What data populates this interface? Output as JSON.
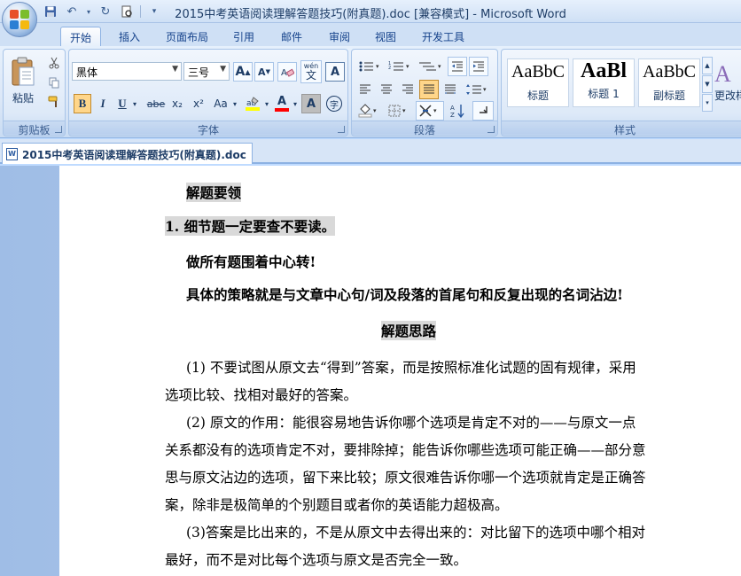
{
  "window": {
    "title": "2015中考英语阅读理解答题技巧(附真题).doc [兼容模式] - Microsoft Word"
  },
  "ribbon_tabs": [
    "开始",
    "插入",
    "页面布局",
    "引用",
    "邮件",
    "审阅",
    "视图",
    "开发工具"
  ],
  "clipboard": {
    "paste_label": "粘贴",
    "group_label": "剪贴板"
  },
  "font": {
    "font_name": "黑体",
    "font_size": "三号",
    "group_label": "字体",
    "bold": "B",
    "italic": "I",
    "underline": "U",
    "strike": "abe",
    "subscript": "x₂",
    "superscript": "x²",
    "change_case": "Aa",
    "grow": "A",
    "shrink": "A",
    "wen": "wén",
    "wen_char": "文",
    "border_char": "A",
    "color_char": "A",
    "shade_char": "A",
    "enclose_char": "字"
  },
  "paragraph": {
    "group_label": "段落"
  },
  "styles": {
    "group_label": "样式",
    "items": [
      {
        "sample": "AaBbC",
        "name": "标题"
      },
      {
        "sample": "AaBl",
        "name": "标题 1"
      },
      {
        "sample": "AaBbC",
        "name": "副标题"
      }
    ],
    "change_styles": "更改样式"
  },
  "document_tab": {
    "name": "2015中考英语阅读理解答题技巧(附真题).doc"
  },
  "document": {
    "heading1": "解题要领",
    "point1": "1. 细节题一定要查不要读。",
    "line_a": "做所有题围着中心转!",
    "line_b": "具体的策略就是与文章中心句/词及段落的首尾句和反复出现的名词沾边!",
    "heading2": "解题思路",
    "p1_l1": "(1) 不要试图从原文去“得到”答案，而是按照标准化试题的固有规律，采用",
    "p1_l2": "选项比较、找相对最好的答案。",
    "p2_l1": "(2) 原文的作用：能很容易地告诉你哪个选项是肯定不对的——与原文一点",
    "p2_l2": "关系都没有的选项肯定不对，要排除掉；能告诉你哪些选项可能正确——部分意",
    "p2_l3": "思与原文沾边的选项，留下来比较；原文很难告诉你哪一个选项就肯定是正确答",
    "p2_l4": "案，除非是极简单的个别题目或者你的英语能力超极高。",
    "p3_l1": "(3)答案是比出来的，不是从原文中去得出来的：对比留下的选项中哪个相对",
    "p3_l2": "最好，而不是对比每个选项与原文是否完全一致。"
  },
  "colors": {
    "ribbon_blue": "#dbe7f7",
    "highlight_yellow": "#ffff00",
    "font_red": "#ff0000",
    "selection_gray": "#d9d9d9"
  }
}
